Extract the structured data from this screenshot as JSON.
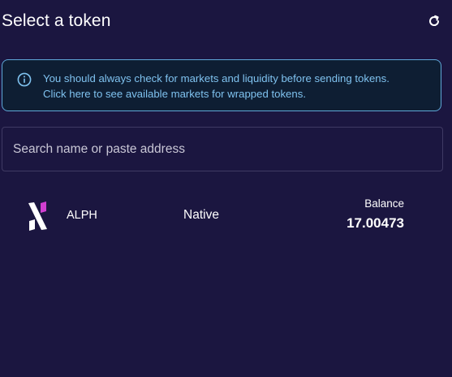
{
  "header": {
    "title": "Select a token",
    "refresh_icon": "refresh-icon"
  },
  "info": {
    "icon": "info-icon",
    "line1": "You should always check for markets and liquidity before sending tokens.",
    "line2": "Click here to see available markets for wrapped tokens."
  },
  "search": {
    "placeholder": "Search name or paste address",
    "value": ""
  },
  "tokens": [
    {
      "symbol": "ALPH",
      "type": "Native",
      "balance_label": "Balance",
      "balance": "17.00473",
      "logo": "alephium-logo"
    }
  ],
  "colors": {
    "background": "#1b1640",
    "info_border": "#5fa8d8",
    "info_text": "#7fc2ef",
    "info_bg": "#0e1e33",
    "logo_accent": "#d13fd1"
  }
}
